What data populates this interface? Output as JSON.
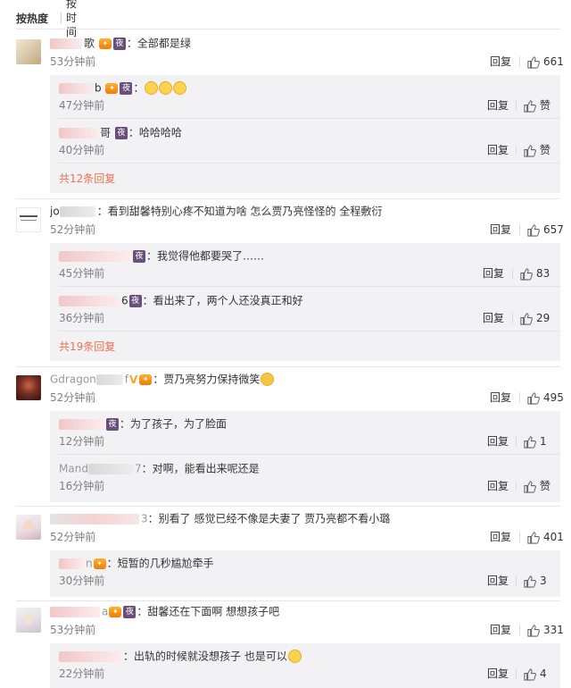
{
  "sortbar": {
    "hot": "按热度",
    "time": "按时间"
  },
  "labels": {
    "reply": "回复",
    "praise": "赞",
    "badge": "夜",
    "crown": "🐱",
    "v": "V"
  },
  "comments": [
    {
      "name_tail": "歌",
      "text": "：全部都是绿",
      "time": "53分钟前",
      "likes": "661",
      "replies": [
        {
          "name_tail": "b",
          "text": "：",
          "time": "47分钟前",
          "likes": "赞"
        },
        {
          "name_tail": "哥",
          "text": "：哈哈哈哈",
          "time": "40分钟前",
          "likes": "赞"
        }
      ],
      "more": "共12条回复"
    },
    {
      "name_head": "jo",
      "text": "：看到甜馨特别心疼不知道为啥 怎么贾乃亮怪怪的 全程敷衍",
      "time": "52分钟前",
      "likes": "657",
      "replies": [
        {
          "text": "：我觉得他都要哭了……",
          "time": "45分钟前",
          "likes": "83"
        },
        {
          "name_tail": "6",
          "text": "：看出来了，两个人还没真正和好",
          "time": "36分钟前",
          "likes": "29"
        }
      ],
      "more": "共19条回复"
    },
    {
      "name_head": "Gdragon",
      "name_tail": "f",
      "text": "：贾乃亮努力保持微笑",
      "time": "52分钟前",
      "likes": "495",
      "replies": [
        {
          "text": "：为了孩子，为了脸面",
          "time": "12分钟前",
          "likes": "1"
        },
        {
          "name_head": "Mand",
          "name_tail": "7",
          "text": "：对啊，能看出来呢还是",
          "time": "16分钟前",
          "likes": "赞"
        }
      ]
    },
    {
      "name_tail": "3",
      "text": "：别看了 感觉已经不像是夫妻了 贾乃亮都不看小璐",
      "time": "52分钟前",
      "likes": "401",
      "replies": [
        {
          "name_tail": "n",
          "text": "：短暂的几秒尴尬牵手",
          "time": "30分钟前",
          "likes": "3"
        }
      ]
    },
    {
      "name_tail": "a",
      "text": "：甜馨还在下面啊 想想孩子吧",
      "time": "53分钟前",
      "likes": "331",
      "replies": [
        {
          "text": "：出轨的时候就没想孩子 也是可以",
          "time": "22分钟前",
          "likes": "4"
        }
      ]
    }
  ],
  "colors": {
    "more_link": "#eb7350",
    "badge": "#6a4f7b",
    "time": "#808080"
  }
}
